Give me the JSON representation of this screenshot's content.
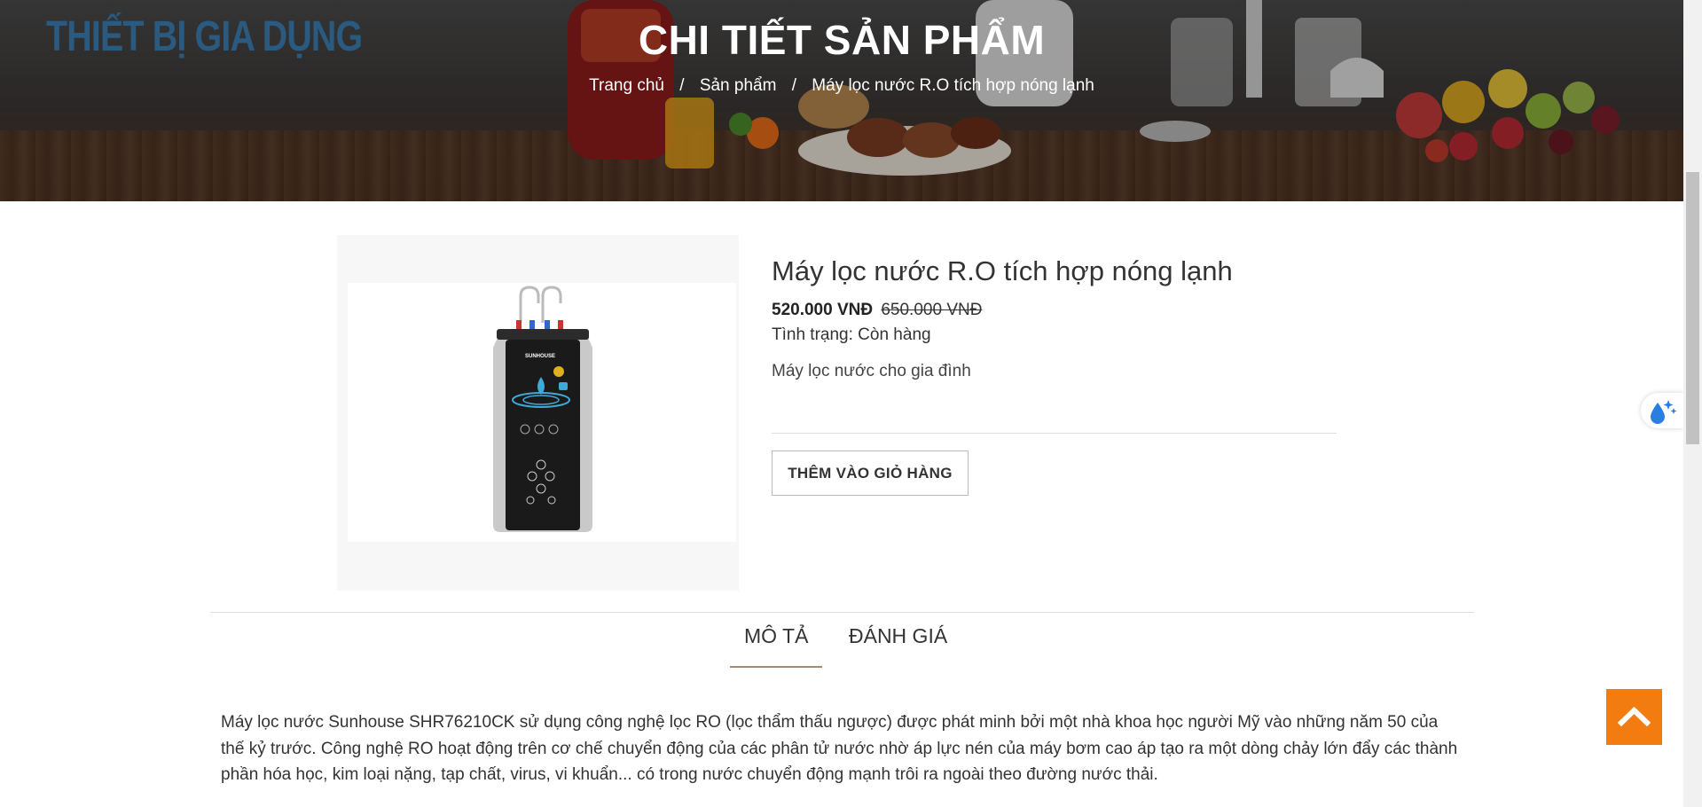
{
  "brand": {
    "logo_text": "THIẾT BỊ GIA DỤNG"
  },
  "hero": {
    "title": "CHI TIẾT SẢN PHẨM",
    "breadcrumb": {
      "home": "Trang chủ",
      "products": "Sản phẩm",
      "current": "Máy lọc nước R.O tích hợp nóng lạnh",
      "separator": "/"
    }
  },
  "product": {
    "name": "Máy lọc nước R.O tích hợp nóng lạnh",
    "price": "520.000 VNĐ",
    "old_price": "650.000 VNĐ",
    "status_label": "Tình trạng:",
    "status_value": "Còn hàng",
    "short_description": "Máy lọc nước cho gia đình",
    "add_to_cart_label": "THÊM VÀO GIỎ HÀNG",
    "image_brand_text": "SUNHOUSE"
  },
  "tabs": [
    {
      "label": "MÔ TẢ",
      "active": true
    },
    {
      "label": "ĐÁNH GIÁ",
      "active": false
    }
  ],
  "description": "Máy lọc nước Sunhouse SHR76210CK sử dụng công nghệ lọc RO (lọc thẩm thấu ngược) được phát minh bởi một nhà khoa học người Mỹ vào những năm 50 của thế kỷ trước. Công nghệ RO hoạt động trên cơ chế chuyển động của các phân tử nước nhờ áp lực nén của máy bơm cao áp tạo ra một dòng chảy lớn đẩy các thành phần hóa học, kim loại nặng, tạp chất, virus, vi khuẩn... có trong nước chuyển động mạnh trôi ra ngoài theo đường nước thải.",
  "icons": {
    "float": "water-drop-sparkle-icon",
    "back_to_top": "chevron-up-icon"
  },
  "colors": {
    "accent": "#f27c10",
    "tab_underline": "#a68b6e",
    "logo": "#2a5a7f"
  }
}
